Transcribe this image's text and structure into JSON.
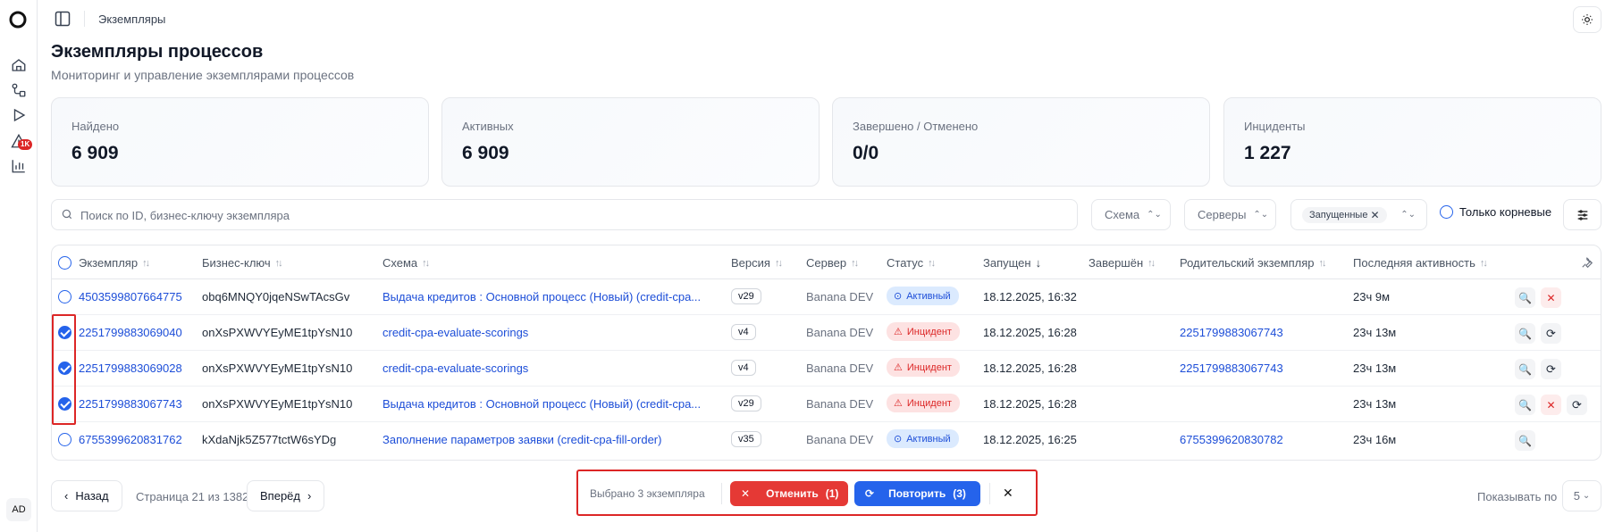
{
  "breadcrumb": "Экземпляры",
  "sidebar": {
    "avatar": "AD",
    "badge": "1K"
  },
  "page": {
    "title": "Экземпляры процессов",
    "subtitle": "Мониторинг и управление экземплярами процессов"
  },
  "stats": [
    {
      "label": "Найдено",
      "value": "6 909"
    },
    {
      "label": "Активных",
      "value": "6 909"
    },
    {
      "label": "Завершено / Отменено",
      "value": "0/0"
    },
    {
      "label": "Инциденты",
      "value": "1 227"
    }
  ],
  "filters": {
    "search_placeholder": "Поиск по ID, бизнес-ключу экземпляра",
    "schema": "Схема",
    "servers": "Серверы",
    "running_chip": "Запущенные",
    "root_only": "Только корневые"
  },
  "columns": [
    "Экземпляр",
    "Бизнес-ключ",
    "Схема",
    "Версия",
    "Сервер",
    "Статус",
    "Запущен",
    "Завершён",
    "Родительский экземпляр",
    "Последняя активность"
  ],
  "rows": [
    {
      "id": "4503599807664775",
      "key": "obq6MNQY0jqeNSwTAcsGv",
      "schema": "Выдача кредитов : Основной процесс (Новый) (credit-cpa...",
      "version": "v29",
      "server": "Banana DEV",
      "status": "Активный",
      "started": "18.12.2025, 16:32",
      "finished": "",
      "parent": "",
      "activity": "23ч 9м",
      "checked": false
    },
    {
      "id": "2251799883069040",
      "key": "onXsPXWVYEyME1tpYsN10",
      "schema": "credit-cpa-evaluate-scorings",
      "version": "v4",
      "server": "Banana DEV",
      "status": "Инцидент",
      "started": "18.12.2025, 16:28",
      "finished": "",
      "parent": "2251799883067743",
      "activity": "23ч 13м",
      "checked": true
    },
    {
      "id": "2251799883069028",
      "key": "onXsPXWVYEyME1tpYsN10",
      "schema": "credit-cpa-evaluate-scorings",
      "version": "v4",
      "server": "Banana DEV",
      "status": "Инцидент",
      "started": "18.12.2025, 16:28",
      "finished": "",
      "parent": "2251799883067743",
      "activity": "23ч 13м",
      "checked": true
    },
    {
      "id": "2251799883067743",
      "key": "onXsPXWVYEyME1tpYsN10",
      "schema": "Выдача кредитов : Основной процесс (Новый) (credit-cpa...",
      "version": "v29",
      "server": "Banana DEV",
      "status": "Инцидент",
      "started": "18.12.2025, 16:28",
      "finished": "",
      "parent": "",
      "activity": "23ч 13м",
      "checked": true
    },
    {
      "id": "6755399620831762",
      "key": "kXdaNjk5Z577tctW6sYDg",
      "schema": "Заполнение параметров заявки (credit-cpa-fill-order)",
      "version": "v35",
      "server": "Banana DEV",
      "status": "Активный",
      "started": "18.12.2025, 16:25",
      "finished": "",
      "parent": "6755399620830782",
      "activity": "23ч 16м",
      "checked": false
    }
  ],
  "pagination": {
    "prev": "Назад",
    "info": "Страница 21 из 1382",
    "next": "Вперёд",
    "per_page_label": "Показывать по",
    "per_page": "5"
  },
  "bulk": {
    "selected": "Выбрано 3 экземпляра",
    "cancel": "Отменить",
    "cancel_count": "(1)",
    "retry": "Повторить",
    "retry_count": "(3)"
  },
  "colors": {
    "accent": "#2563eb",
    "danger": "#dc2626",
    "link": "#1d4ed8"
  }
}
